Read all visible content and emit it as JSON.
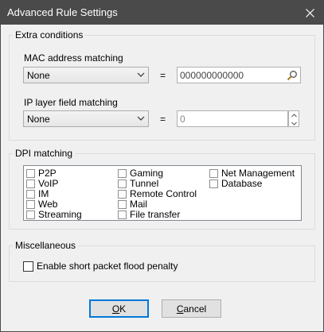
{
  "window": {
    "title": "Advanced Rule Settings"
  },
  "extra": {
    "group_title": "Extra conditions",
    "mac": {
      "label": "MAC address matching",
      "selected": "None",
      "equals": "=",
      "value": "000000000000"
    },
    "ip": {
      "label": "IP layer field matching",
      "selected": "None",
      "equals": "=",
      "value": "0"
    }
  },
  "dpi": {
    "group_title": "DPI matching",
    "col1": [
      "P2P",
      "VoIP",
      "IM",
      "Web",
      "Streaming"
    ],
    "col2": [
      "Gaming",
      "Tunnel",
      "Remote Control",
      "Mail",
      "File transfer"
    ],
    "col3": [
      "Net Management",
      "Database"
    ]
  },
  "misc": {
    "group_title": "Miscellaneous",
    "checkbox_label": "Enable short packet flood penalty"
  },
  "buttons": {
    "ok_prefix": "",
    "ok_u": "O",
    "ok_rest": "K",
    "cancel_prefix": "",
    "cancel_u": "C",
    "cancel_rest": "ancel"
  }
}
